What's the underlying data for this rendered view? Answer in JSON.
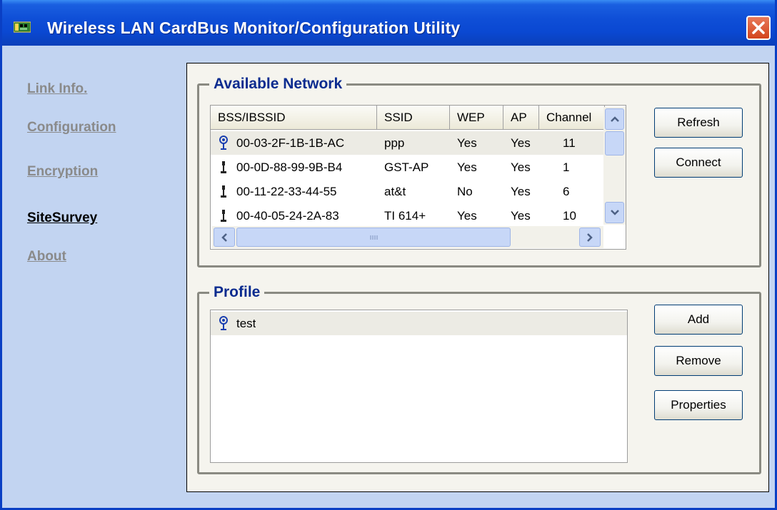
{
  "window": {
    "title": "Wireless LAN CardBus Monitor/Configuration Utility",
    "icon": "network-card-icon",
    "close_icon": "close-icon"
  },
  "nav": {
    "items": [
      {
        "label": "Link Info.",
        "active": false
      },
      {
        "label": "Configuration",
        "active": false
      },
      {
        "label": "Encryption",
        "active": false
      },
      {
        "label": "SiteSurvey",
        "active": true
      },
      {
        "label": "About",
        "active": false
      }
    ]
  },
  "available_network": {
    "title": "Available Network",
    "columns": [
      "BSS/IBSSID",
      "SSID",
      "WEP",
      "AP",
      "Channel"
    ],
    "rows": [
      {
        "icon": "antenna-signal-icon",
        "bssid": "00-03-2F-1B-1B-AC",
        "ssid": "ppp",
        "wep": "Yes",
        "ap": "Yes",
        "channel": "11"
      },
      {
        "icon": "antenna-icon",
        "bssid": "00-0D-88-99-9B-B4",
        "ssid": "GST-AP",
        "wep": "Yes",
        "ap": "Yes",
        "channel": "1"
      },
      {
        "icon": "antenna-icon",
        "bssid": "00-11-22-33-44-55",
        "ssid": "at&t",
        "wep": "No",
        "ap": "Yes",
        "channel": "6"
      },
      {
        "icon": "antenna-icon",
        "bssid": "00-40-05-24-2A-83",
        "ssid": "TI 614+",
        "wep": "Yes",
        "ap": "Yes",
        "channel": "10"
      }
    ],
    "buttons": {
      "refresh": "Refresh",
      "connect": "Connect"
    }
  },
  "profile": {
    "title": "Profile",
    "items": [
      {
        "icon": "antenna-signal-icon",
        "label": "test"
      }
    ],
    "buttons": {
      "add": "Add",
      "remove": "Remove",
      "properties": "Properties"
    }
  },
  "colors": {
    "titlebar": "#0a48d2",
    "window_bg": "#c2d4f1",
    "group_title": "#0a2b8f",
    "nav_inactive": "#8a8a8a"
  }
}
